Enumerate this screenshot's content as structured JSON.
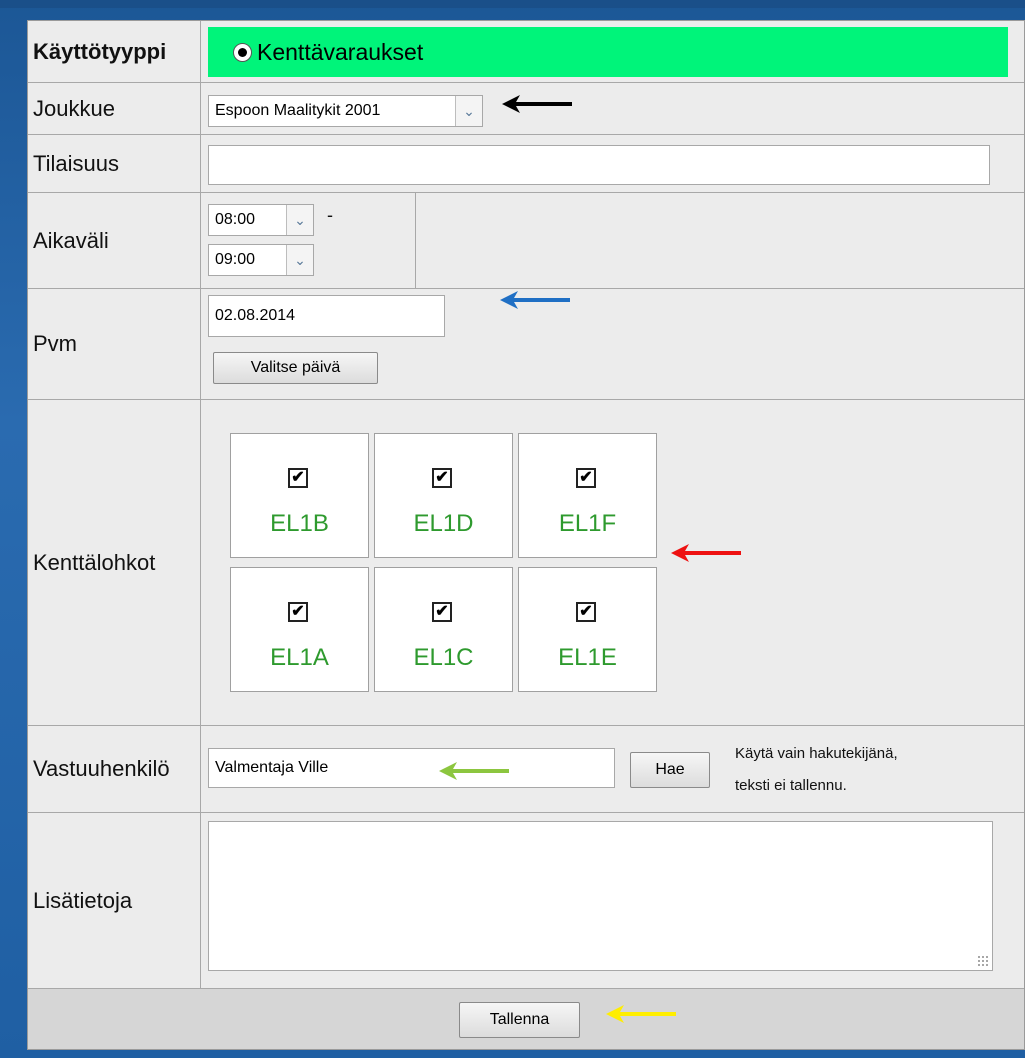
{
  "form": {
    "usage_type": {
      "label": "Käyttötyyppi",
      "option": "Kenttävaraukset"
    },
    "team": {
      "label": "Joukkue",
      "value": "Espoon Maalitykit 2001"
    },
    "event": {
      "label": "Tilaisuus",
      "value": ""
    },
    "time_range": {
      "label": "Aikaväli",
      "start": "08:00",
      "separator": "-",
      "end": "09:00"
    },
    "date": {
      "label": "Pvm",
      "value": "02.08.2014",
      "pick_button": "Valitse päivä"
    },
    "field_blocks": {
      "label": "Kenttälohkot",
      "tiles": [
        {
          "name": "EL1B",
          "checked": true
        },
        {
          "name": "EL1D",
          "checked": true
        },
        {
          "name": "EL1F",
          "checked": true
        },
        {
          "name": "EL1A",
          "checked": true
        },
        {
          "name": "EL1C",
          "checked": true
        },
        {
          "name": "EL1E",
          "checked": true
        }
      ],
      "check_glyph": "✔"
    },
    "responsible": {
      "label": "Vastuuhenkilö",
      "value": "Valmentaja Ville",
      "search_button": "Hae",
      "note_line1": "Käytä vain hakutekijänä,",
      "note_line2": "teksti ei tallennu."
    },
    "extra_info": {
      "label": "Lisätietoja",
      "value": ""
    },
    "save_button": "Tallenna"
  },
  "colors": {
    "radio_bar": "#00f47a",
    "tile_label": "#2e9a2e",
    "arrow_black": "#000000",
    "arrow_blue": "#1f6fc4",
    "arrow_red": "#ee1111",
    "arrow_green": "#8cc63f",
    "arrow_yellow": "#ffee00"
  },
  "icons": {
    "select_arrow": "chevron-down-icon",
    "radio": "radio-selected-icon",
    "checkbox": "checkbox-checked-icon",
    "resize": "resize-grip-icon"
  }
}
